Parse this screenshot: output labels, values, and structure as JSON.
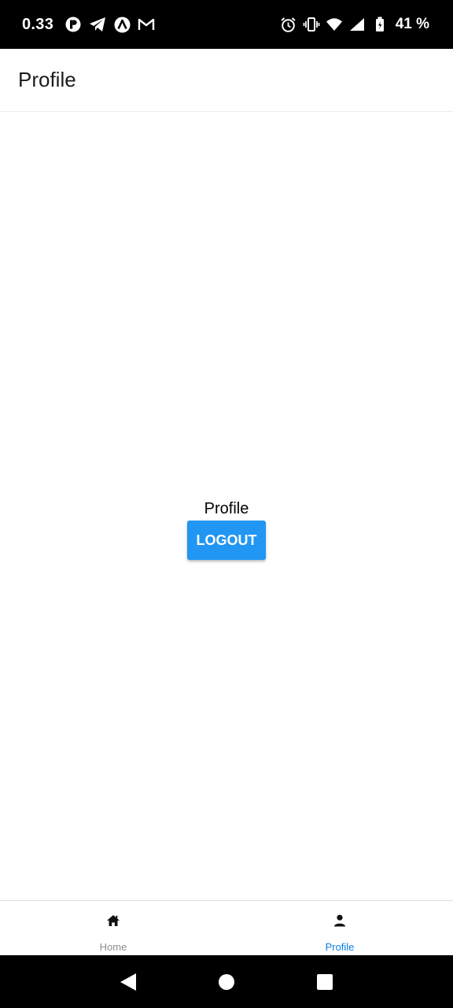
{
  "status_bar": {
    "time": "0.33",
    "battery_text": "41 %",
    "left_icons": [
      "app-r-icon",
      "telegram-icon",
      "arc-app-icon",
      "gmail-icon"
    ],
    "right_icons": [
      "alarm-icon",
      "vibrate-icon",
      "wifi-icon",
      "signal-icon",
      "battery-icon"
    ]
  },
  "header": {
    "title": "Profile"
  },
  "main": {
    "text": "Profile",
    "logout_label": "LOGOUT"
  },
  "tab_bar": {
    "tabs": [
      {
        "label": "Home",
        "icon": "home-icon",
        "active": false
      },
      {
        "label": "Profile",
        "icon": "person-icon",
        "active": true
      }
    ]
  },
  "colors": {
    "accent": "#2196f3",
    "active_tab": "#0a7fe0",
    "inactive_tab": "#8e8e93"
  },
  "nav_bar": {
    "buttons": [
      "back-icon",
      "home-circle-icon",
      "recents-icon"
    ]
  }
}
